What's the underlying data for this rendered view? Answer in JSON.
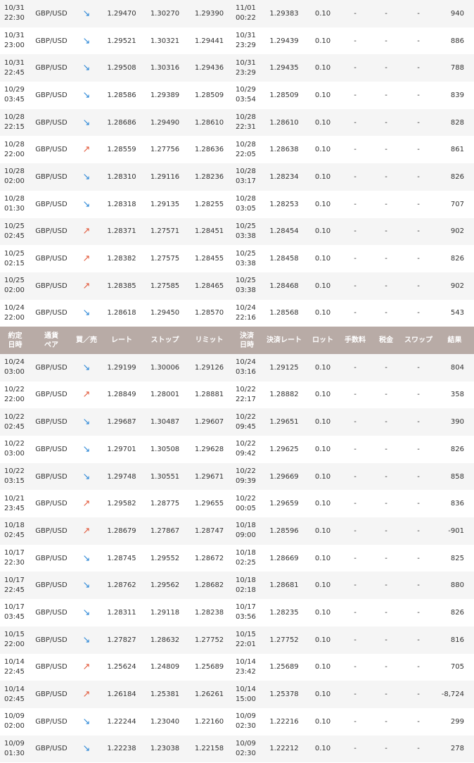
{
  "colors": {
    "header_bg": "#b8aba6",
    "up_arrow": "#e2583a",
    "down_arrow": "#2a86d6",
    "stripe": "#f5f5f5"
  },
  "header": {
    "entry_date": [
      "約定",
      "日時"
    ],
    "pair": [
      "通貨",
      "ペア"
    ],
    "side": "買／売",
    "rate": "レート",
    "stop": "ストップ",
    "limit": "リミット",
    "settle_date": [
      "決済",
      "日時"
    ],
    "settle_rate": "決済レート",
    "lot": "ロット",
    "fee": "手数料",
    "tax": "税金",
    "swap": "スワップ",
    "result": "結果"
  },
  "groups": [
    {
      "rows": [
        {
          "d1": "10/31",
          "d2": "22:30",
          "pair": "GBP/USD",
          "dir": "down",
          "rate": "1.29470",
          "stop": "1.30270",
          "limit": "1.29390",
          "s1": "11/01",
          "s2": "00:22",
          "srate": "1.29383",
          "lot": "0.10",
          "fee": "-",
          "tax": "-",
          "swap": "-",
          "result": "940"
        },
        {
          "d1": "10/31",
          "d2": "23:00",
          "pair": "GBP/USD",
          "dir": "down",
          "rate": "1.29521",
          "stop": "1.30321",
          "limit": "1.29441",
          "s1": "10/31",
          "s2": "23:29",
          "srate": "1.29439",
          "lot": "0.10",
          "fee": "-",
          "tax": "-",
          "swap": "-",
          "result": "886"
        },
        {
          "d1": "10/31",
          "d2": "22:45",
          "pair": "GBP/USD",
          "dir": "down",
          "rate": "1.29508",
          "stop": "1.30316",
          "limit": "1.29436",
          "s1": "10/31",
          "s2": "23:29",
          "srate": "1.29435",
          "lot": "0.10",
          "fee": "-",
          "tax": "-",
          "swap": "-",
          "result": "788"
        },
        {
          "d1": "10/29",
          "d2": "03:45",
          "pair": "GBP/USD",
          "dir": "down",
          "rate": "1.28586",
          "stop": "1.29389",
          "limit": "1.28509",
          "s1": "10/29",
          "s2": "03:54",
          "srate": "1.28509",
          "lot": "0.10",
          "fee": "-",
          "tax": "-",
          "swap": "-",
          "result": "839"
        },
        {
          "d1": "10/28",
          "d2": "22:15",
          "pair": "GBP/USD",
          "dir": "down",
          "rate": "1.28686",
          "stop": "1.29490",
          "limit": "1.28610",
          "s1": "10/28",
          "s2": "22:31",
          "srate": "1.28610",
          "lot": "0.10",
          "fee": "-",
          "tax": "-",
          "swap": "-",
          "result": "828"
        },
        {
          "d1": "10/28",
          "d2": "22:00",
          "pair": "GBP/USD",
          "dir": "up",
          "rate": "1.28559",
          "stop": "1.27756",
          "limit": "1.28636",
          "s1": "10/28",
          "s2": "22:05",
          "srate": "1.28638",
          "lot": "0.10",
          "fee": "-",
          "tax": "-",
          "swap": "-",
          "result": "861"
        },
        {
          "d1": "10/28",
          "d2": "02:00",
          "pair": "GBP/USD",
          "dir": "down",
          "rate": "1.28310",
          "stop": "1.29116",
          "limit": "1.28236",
          "s1": "10/28",
          "s2": "03:17",
          "srate": "1.28234",
          "lot": "0.10",
          "fee": "-",
          "tax": "-",
          "swap": "-",
          "result": "826"
        },
        {
          "d1": "10/28",
          "d2": "01:30",
          "pair": "GBP/USD",
          "dir": "down",
          "rate": "1.28318",
          "stop": "1.29135",
          "limit": "1.28255",
          "s1": "10/28",
          "s2": "03:05",
          "srate": "1.28253",
          "lot": "0.10",
          "fee": "-",
          "tax": "-",
          "swap": "-",
          "result": "707"
        },
        {
          "d1": "10/25",
          "d2": "02:45",
          "pair": "GBP/USD",
          "dir": "up",
          "rate": "1.28371",
          "stop": "1.27571",
          "limit": "1.28451",
          "s1": "10/25",
          "s2": "03:38",
          "srate": "1.28454",
          "lot": "0.10",
          "fee": "-",
          "tax": "-",
          "swap": "-",
          "result": "902"
        },
        {
          "d1": "10/25",
          "d2": "02:15",
          "pair": "GBP/USD",
          "dir": "up",
          "rate": "1.28382",
          "stop": "1.27575",
          "limit": "1.28455",
          "s1": "10/25",
          "s2": "03:38",
          "srate": "1.28458",
          "lot": "0.10",
          "fee": "-",
          "tax": "-",
          "swap": "-",
          "result": "826"
        },
        {
          "d1": "10/25",
          "d2": "02:00",
          "pair": "GBP/USD",
          "dir": "up",
          "rate": "1.28385",
          "stop": "1.27585",
          "limit": "1.28465",
          "s1": "10/25",
          "s2": "03:38",
          "srate": "1.28468",
          "lot": "0.10",
          "fee": "-",
          "tax": "-",
          "swap": "-",
          "result": "902"
        },
        {
          "d1": "10/24",
          "d2": "22:00",
          "pair": "GBP/USD",
          "dir": "down",
          "rate": "1.28618",
          "stop": "1.29450",
          "limit": "1.28570",
          "s1": "10/24",
          "s2": "22:16",
          "srate": "1.28568",
          "lot": "0.10",
          "fee": "-",
          "tax": "-",
          "swap": "-",
          "result": "543"
        }
      ]
    },
    {
      "rows": [
        {
          "d1": "10/24",
          "d2": "03:00",
          "pair": "GBP/USD",
          "dir": "down",
          "rate": "1.29199",
          "stop": "1.30006",
          "limit": "1.29126",
          "s1": "10/24",
          "s2": "03:16",
          "srate": "1.29125",
          "lot": "0.10",
          "fee": "-",
          "tax": "-",
          "swap": "-",
          "result": "804"
        },
        {
          "d1": "10/22",
          "d2": "22:00",
          "pair": "GBP/USD",
          "dir": "up",
          "rate": "1.28849",
          "stop": "1.28001",
          "limit": "1.28881",
          "s1": "10/22",
          "s2": "22:17",
          "srate": "1.28882",
          "lot": "0.10",
          "fee": "-",
          "tax": "-",
          "swap": "-",
          "result": "358"
        },
        {
          "d1": "10/22",
          "d2": "02:45",
          "pair": "GBP/USD",
          "dir": "down",
          "rate": "1.29687",
          "stop": "1.30487",
          "limit": "1.29607",
          "s1": "10/22",
          "s2": "09:45",
          "srate": "1.29651",
          "lot": "0.10",
          "fee": "-",
          "tax": "-",
          "swap": "-",
          "result": "390"
        },
        {
          "d1": "10/22",
          "d2": "03:00",
          "pair": "GBP/USD",
          "dir": "down",
          "rate": "1.29701",
          "stop": "1.30508",
          "limit": "1.29628",
          "s1": "10/22",
          "s2": "09:42",
          "srate": "1.29625",
          "lot": "0.10",
          "fee": "-",
          "tax": "-",
          "swap": "-",
          "result": "826"
        },
        {
          "d1": "10/22",
          "d2": "03:15",
          "pair": "GBP/USD",
          "dir": "down",
          "rate": "1.29748",
          "stop": "1.30551",
          "limit": "1.29671",
          "s1": "10/22",
          "s2": "09:39",
          "srate": "1.29669",
          "lot": "0.10",
          "fee": "-",
          "tax": "-",
          "swap": "-",
          "result": "858"
        },
        {
          "d1": "10/21",
          "d2": "23:45",
          "pair": "GBP/USD",
          "dir": "up",
          "rate": "1.29582",
          "stop": "1.28775",
          "limit": "1.29655",
          "s1": "10/22",
          "s2": "00:05",
          "srate": "1.29659",
          "lot": "0.10",
          "fee": "-",
          "tax": "-",
          "swap": "-",
          "result": "836"
        },
        {
          "d1": "10/18",
          "d2": "02:45",
          "pair": "GBP/USD",
          "dir": "up",
          "rate": "1.28679",
          "stop": "1.27867",
          "limit": "1.28747",
          "s1": "10/18",
          "s2": "09:00",
          "srate": "1.28596",
          "lot": "0.10",
          "fee": "-",
          "tax": "-",
          "swap": "-",
          "result": "-901"
        },
        {
          "d1": "10/17",
          "d2": "22:30",
          "pair": "GBP/USD",
          "dir": "down",
          "rate": "1.28745",
          "stop": "1.29552",
          "limit": "1.28672",
          "s1": "10/18",
          "s2": "02:25",
          "srate": "1.28669",
          "lot": "0.10",
          "fee": "-",
          "tax": "-",
          "swap": "-",
          "result": "825"
        },
        {
          "d1": "10/17",
          "d2": "22:45",
          "pair": "GBP/USD",
          "dir": "down",
          "rate": "1.28762",
          "stop": "1.29562",
          "limit": "1.28682",
          "s1": "10/18",
          "s2": "02:18",
          "srate": "1.28681",
          "lot": "0.10",
          "fee": "-",
          "tax": "-",
          "swap": "-",
          "result": "880"
        },
        {
          "d1": "10/17",
          "d2": "03:45",
          "pair": "GBP/USD",
          "dir": "down",
          "rate": "1.28311",
          "stop": "1.29118",
          "limit": "1.28238",
          "s1": "10/17",
          "s2": "03:56",
          "srate": "1.28235",
          "lot": "0.10",
          "fee": "-",
          "tax": "-",
          "swap": "-",
          "result": "826"
        },
        {
          "d1": "10/15",
          "d2": "22:00",
          "pair": "GBP/USD",
          "dir": "down",
          "rate": "1.27827",
          "stop": "1.28632",
          "limit": "1.27752",
          "s1": "10/15",
          "s2": "22:01",
          "srate": "1.27752",
          "lot": "0.10",
          "fee": "-",
          "tax": "-",
          "swap": "-",
          "result": "816"
        },
        {
          "d1": "10/14",
          "d2": "22:45",
          "pair": "GBP/USD",
          "dir": "up",
          "rate": "1.25624",
          "stop": "1.24809",
          "limit": "1.25689",
          "s1": "10/14",
          "s2": "23:42",
          "srate": "1.25689",
          "lot": "0.10",
          "fee": "-",
          "tax": "-",
          "swap": "-",
          "result": "705"
        },
        {
          "d1": "10/14",
          "d2": "02:45",
          "pair": "GBP/USD",
          "dir": "up",
          "rate": "1.26184",
          "stop": "1.25381",
          "limit": "1.26261",
          "s1": "10/14",
          "s2": "15:00",
          "srate": "1.25378",
          "lot": "0.10",
          "fee": "-",
          "tax": "-",
          "swap": "-",
          "result": "-8,724"
        },
        {
          "d1": "10/09",
          "d2": "02:00",
          "pair": "GBP/USD",
          "dir": "down",
          "rate": "1.22244",
          "stop": "1.23040",
          "limit": "1.22160",
          "s1": "10/09",
          "s2": "02:30",
          "srate": "1.22216",
          "lot": "0.10",
          "fee": "-",
          "tax": "-",
          "swap": "-",
          "result": "299"
        },
        {
          "d1": "10/09",
          "d2": "01:30",
          "pair": "GBP/USD",
          "dir": "down",
          "rate": "1.22238",
          "stop": "1.23038",
          "limit": "1.22158",
          "s1": "10/09",
          "s2": "02:30",
          "srate": "1.22212",
          "lot": "0.10",
          "fee": "-",
          "tax": "-",
          "swap": "-",
          "result": "278"
        }
      ]
    }
  ]
}
